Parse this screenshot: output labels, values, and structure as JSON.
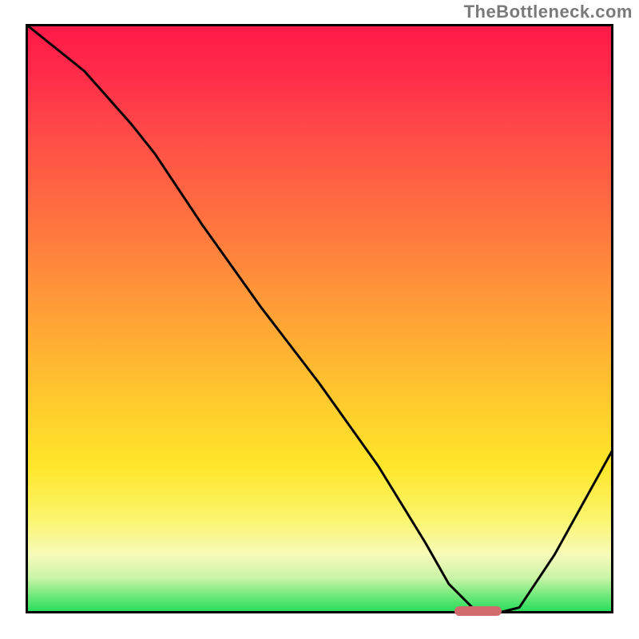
{
  "watermark": "TheBottleneck.com",
  "chart_data": {
    "type": "line",
    "title": "",
    "xlabel": "",
    "ylabel": "",
    "xlim": [
      0,
      100
    ],
    "ylim": [
      0,
      100
    ],
    "series": [
      {
        "name": "curve",
        "x": [
          0,
          10,
          18,
          22,
          30,
          40,
          50,
          60,
          68,
          72,
          76,
          80,
          84,
          90,
          100
        ],
        "y": [
          100,
          92,
          83,
          78,
          66,
          52,
          39,
          25,
          12,
          5,
          1,
          0,
          1,
          10,
          28
        ]
      }
    ],
    "optimal_marker": {
      "x_start": 73,
      "x_end": 81,
      "y": 0
    },
    "gradient_stops": [
      {
        "pos": 0,
        "color": "#ff1947"
      },
      {
        "pos": 50,
        "color": "#ffa336"
      },
      {
        "pos": 75,
        "color": "#ffe62a"
      },
      {
        "pos": 94,
        "color": "#c9f4a5"
      },
      {
        "pos": 100,
        "color": "#1fdc58"
      }
    ]
  }
}
